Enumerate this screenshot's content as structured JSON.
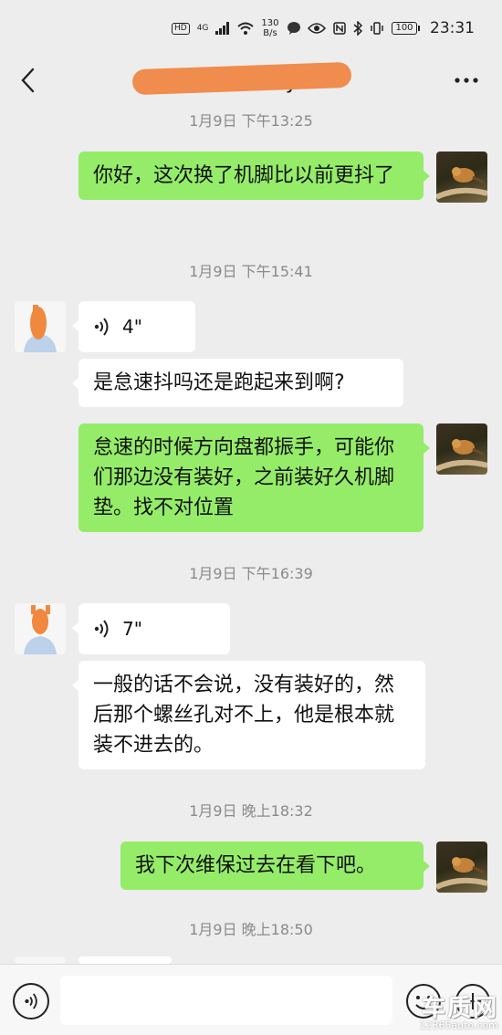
{
  "status_bar": {
    "hd_badge": "HD",
    "net": "4G",
    "speed_value": "130",
    "speed_unit": "B/s",
    "battery": "100",
    "time": "23:31"
  },
  "header": {
    "title_visible": "张 ... wey",
    "back_icon": "chevron-left-icon",
    "more_icon": "more-dots-icon"
  },
  "messages": [
    {
      "type": "time",
      "text": "1月9日 下午13:25"
    },
    {
      "type": "text",
      "side": "right",
      "text": "你好，这次换了机脚比以前更抖了"
    },
    {
      "type": "time",
      "text": "1月9日 下午15:41"
    },
    {
      "type": "voice",
      "side": "left",
      "duration": "4\""
    },
    {
      "type": "text",
      "side": "left",
      "text": "是怠速抖吗还是跑起来到啊?"
    },
    {
      "type": "text",
      "side": "right",
      "text": "怠速的时候方向盘都振手，可能你们那边没有装好，之前装好久机脚垫。找不对位置"
    },
    {
      "type": "time",
      "text": "1月9日 下午16:39"
    },
    {
      "type": "voice",
      "side": "left",
      "duration": "7\""
    },
    {
      "type": "text",
      "side": "left",
      "text": "一般的话不会说，没有装好的，然后那个螺丝孔对不上，他是根本就装不进去的。"
    },
    {
      "type": "time",
      "text": "1月9日 晚上18:32"
    },
    {
      "type": "text",
      "side": "right",
      "text": "我下次维保过去在看下吧。"
    },
    {
      "type": "time",
      "text": "1月9日 晚上18:50"
    }
  ],
  "input_bar": {
    "voice_icon": "voice-mode-icon",
    "emoji_icon": "emoji-icon",
    "plus_icon": "plus-icon",
    "placeholder": ""
  },
  "watermark": {
    "brand": "车质网",
    "url": "12365auto.com"
  },
  "colors": {
    "background": "#ededed",
    "sent_bubble": "#95ec69",
    "received_bubble": "#ffffff",
    "timestamp": "#8a8a8a",
    "redaction": "#f08c4d"
  }
}
